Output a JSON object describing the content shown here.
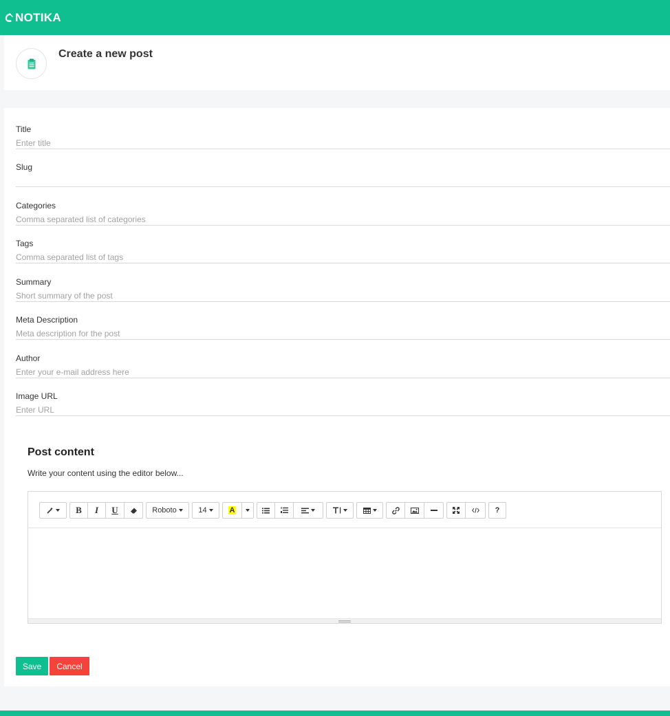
{
  "brand": {
    "name": "NOTIKA"
  },
  "header": {
    "title": "Create a new post",
    "icon": "clipboard-icon"
  },
  "form": {
    "fields": [
      {
        "label": "Title",
        "placeholder": "Enter title",
        "value": ""
      },
      {
        "label": "Slug",
        "placeholder": "",
        "value": ""
      },
      {
        "label": "Categories",
        "placeholder": "Comma separated list of categories",
        "value": ""
      },
      {
        "label": "Tags",
        "placeholder": "Comma separated list of tags",
        "value": ""
      },
      {
        "label": "Summary",
        "placeholder": "Short summary of the post",
        "value": ""
      },
      {
        "label": "Meta Description",
        "placeholder": "Meta description for the post",
        "value": ""
      },
      {
        "label": "Author",
        "placeholder": "Enter your e-mail address here",
        "value": ""
      },
      {
        "label": "Image URL",
        "placeholder": "Enter URL",
        "value": ""
      }
    ]
  },
  "content": {
    "title": "Post content",
    "description": "Write your content using the editor below...",
    "toolbar": {
      "font_family": "Roboto",
      "font_size": "14",
      "bold": "B",
      "italic": "I",
      "underline": "U",
      "color_letter": "A",
      "help": "?"
    }
  },
  "actions": {
    "save_label": "Save",
    "cancel_label": "Cancel"
  },
  "colors": {
    "brand": "#10bf8f",
    "danger": "#f4433a",
    "highlight": "#ffff00"
  }
}
